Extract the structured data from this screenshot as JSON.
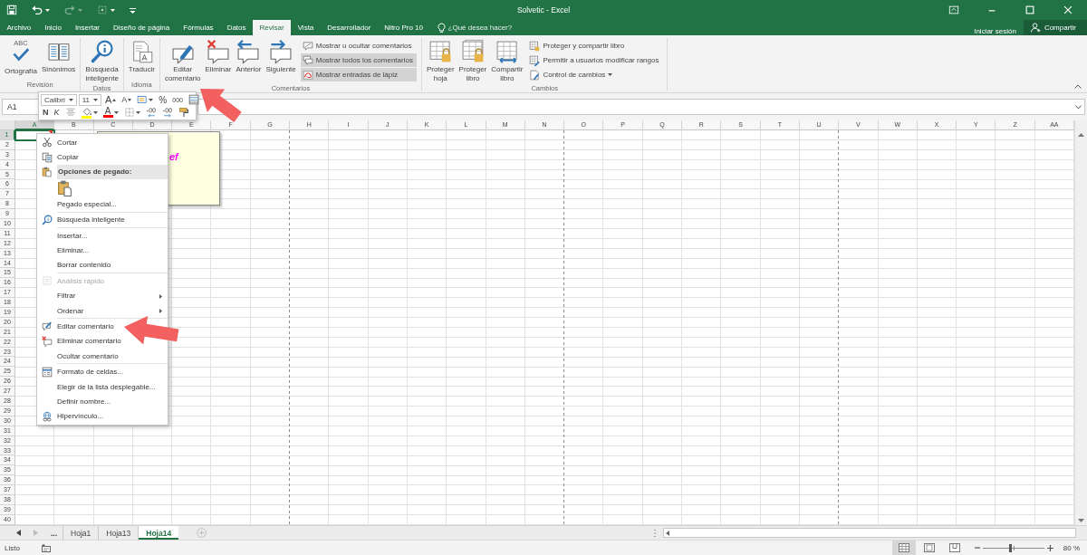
{
  "window": {
    "title": "Solvetic - Excel"
  },
  "tabs": [
    {
      "label": "Archivo",
      "selected": false
    },
    {
      "label": "Inicio",
      "selected": false
    },
    {
      "label": "Insertar",
      "selected": false
    },
    {
      "label": "Diseño de página",
      "selected": false
    },
    {
      "label": "Fórmulas",
      "selected": false
    },
    {
      "label": "Datos",
      "selected": false
    },
    {
      "label": "Revisar",
      "selected": true
    },
    {
      "label": "Vista",
      "selected": false
    },
    {
      "label": "Desarrollador",
      "selected": false
    },
    {
      "label": "Nitro Pro 10",
      "selected": false
    }
  ],
  "tell_me": {
    "placeholder": "¿Qué desea hacer?"
  },
  "sign_in": "Iniciar sesión",
  "share_button": "Compartir",
  "ribbon": {
    "groups": [
      {
        "label": "Revisión",
        "large": [
          {
            "label": "Ortografía",
            "kind": "spelling",
            "icon_text": "ABC"
          },
          {
            "label": "Sinónimos",
            "kind": "thesaurus"
          }
        ]
      },
      {
        "label": "Datos",
        "large": [
          {
            "label": "Búsqueda inteligente",
            "kind": "smart-lookup"
          }
        ]
      },
      {
        "label": "Idioma",
        "large": [
          {
            "label": "Traducir",
            "kind": "translate"
          }
        ]
      },
      {
        "label": "Comentarios",
        "large": [
          {
            "label": "Editar comentario",
            "kind": "edit-comment"
          },
          {
            "label": "Eliminar",
            "kind": "delete-comment"
          },
          {
            "label": "Anterior",
            "kind": "previous-comment"
          },
          {
            "label": "Siguiente",
            "kind": "next-comment"
          }
        ],
        "small": [
          {
            "label": "Mostrar u ocultar comentarios",
            "kind": "show-comment",
            "selected": false,
            "dropdown": false
          },
          {
            "label": "Mostrar todos los comentarios",
            "kind": "show-all",
            "selected": true,
            "dropdown": false
          },
          {
            "label": "Mostrar entradas de lápiz",
            "kind": "ink",
            "selected": true,
            "dropdown": false
          }
        ]
      },
      {
        "label": "Cambios",
        "large": [
          {
            "label": "Proteger hoja",
            "kind": "protect-sheet"
          },
          {
            "label": "Proteger libro",
            "kind": "protect-book"
          },
          {
            "label": "Compartir libro",
            "kind": "share-book"
          }
        ],
        "small": [
          {
            "label": "Proteger y compartir libro",
            "kind": "protect-share",
            "selected": false,
            "dropdown": false
          },
          {
            "label": "Permitir a usuarios modificar rangos",
            "kind": "allow-ranges",
            "selected": false,
            "dropdown": false
          },
          {
            "label": "Control de cambios",
            "kind": "track-changes",
            "selected": false,
            "dropdown": true
          }
        ]
      }
    ]
  },
  "formula_bar": {
    "name_box": "A1"
  },
  "mini_toolbar": {
    "top_row": [
      {
        "kind": "font-box",
        "value": "Calibri"
      },
      {
        "kind": "size-box",
        "value": "11"
      },
      {
        "kind": "grow",
        "label": "A"
      },
      {
        "kind": "shrink",
        "label": "A"
      },
      {
        "kind": "cell-styles"
      },
      {
        "kind": "percent",
        "label": "%"
      },
      {
        "kind": "thousands",
        "label": "000"
      },
      {
        "kind": "format-table"
      }
    ],
    "bottom_row": [
      {
        "kind": "bold",
        "label": "N"
      },
      {
        "kind": "italic",
        "label": "K"
      },
      {
        "kind": "align"
      },
      {
        "kind": "fill",
        "color": "#ffff00"
      },
      {
        "kind": "font-color",
        "label": "A",
        "color": "#ff0000"
      },
      {
        "kind": "borders"
      },
      {
        "kind": "increase-decimals"
      },
      {
        "kind": "decrease-decimals"
      },
      {
        "kind": "painter"
      }
    ]
  },
  "sheet": {
    "columns": [
      {
        "label": "A",
        "selected": true,
        "page_break": false
      },
      {
        "label": "B",
        "selected": false,
        "page_break": false
      },
      {
        "label": "C",
        "selected": false,
        "page_break": false
      },
      {
        "label": "D",
        "selected": false,
        "page_break": false
      },
      {
        "label": "E",
        "selected": false,
        "page_break": false
      },
      {
        "label": "F",
        "selected": false,
        "page_break": false
      },
      {
        "label": "G",
        "selected": false,
        "page_break": true
      },
      {
        "label": "H",
        "selected": false,
        "page_break": false
      },
      {
        "label": "I",
        "selected": false,
        "page_break": false
      },
      {
        "label": "J",
        "selected": false,
        "page_break": false
      },
      {
        "label": "K",
        "selected": false,
        "page_break": false
      },
      {
        "label": "L",
        "selected": false,
        "page_break": false
      },
      {
        "label": "M",
        "selected": false,
        "page_break": false
      },
      {
        "label": "N",
        "selected": false,
        "page_break": true
      },
      {
        "label": "O",
        "selected": false,
        "page_break": false
      },
      {
        "label": "P",
        "selected": false,
        "page_break": false
      },
      {
        "label": "Q",
        "selected": false,
        "page_break": false
      },
      {
        "label": "R",
        "selected": false,
        "page_break": false
      },
      {
        "label": "S",
        "selected": false,
        "page_break": false
      },
      {
        "label": "T",
        "selected": false,
        "page_break": false
      },
      {
        "label": "U",
        "selected": false,
        "page_break": true
      },
      {
        "label": "V",
        "selected": false,
        "page_break": false
      },
      {
        "label": "W",
        "selected": false,
        "page_break": false
      },
      {
        "label": "X",
        "selected": false,
        "page_break": false
      },
      {
        "label": "Y",
        "selected": false,
        "page_break": false
      },
      {
        "label": "Z",
        "selected": false,
        "page_break": false
      },
      {
        "label": "AA",
        "selected": false,
        "page_break": false
      }
    ],
    "rows": [
      {
        "label": "1",
        "selected": true
      },
      {
        "label": "2",
        "selected": false
      },
      {
        "label": "3",
        "selected": false
      },
      {
        "label": "4",
        "selected": false
      },
      {
        "label": "5",
        "selected": false
      },
      {
        "label": "6",
        "selected": false
      },
      {
        "label": "7",
        "selected": false
      },
      {
        "label": "8",
        "selected": false
      },
      {
        "label": "9",
        "selected": false
      },
      {
        "label": "10",
        "selected": false
      },
      {
        "label": "11",
        "selected": false
      },
      {
        "label": "12",
        "selected": false
      },
      {
        "label": "13",
        "selected": false
      },
      {
        "label": "14",
        "selected": false
      },
      {
        "label": "15",
        "selected": false
      },
      {
        "label": "16",
        "selected": false
      },
      {
        "label": "17",
        "selected": false
      },
      {
        "label": "18",
        "selected": false
      },
      {
        "label": "19",
        "selected": false
      },
      {
        "label": "20",
        "selected": false
      },
      {
        "label": "21",
        "selected": false
      },
      {
        "label": "22",
        "selected": false
      },
      {
        "label": "23",
        "selected": false
      },
      {
        "label": "24",
        "selected": false
      },
      {
        "label": "25",
        "selected": false
      },
      {
        "label": "26",
        "selected": false
      },
      {
        "label": "27",
        "selected": false
      },
      {
        "label": "28",
        "selected": false
      },
      {
        "label": "29",
        "selected": false
      },
      {
        "label": "30",
        "selected": false
      },
      {
        "label": "31",
        "selected": false
      },
      {
        "label": "32",
        "selected": false
      },
      {
        "label": "33",
        "selected": false
      },
      {
        "label": "34",
        "selected": false
      },
      {
        "label": "35",
        "selected": false
      },
      {
        "label": "36",
        "selected": false
      },
      {
        "label": "37",
        "selected": false
      },
      {
        "label": "38",
        "selected": false
      },
      {
        "label": "39",
        "selected": false
      },
      {
        "label": "40",
        "selected": false
      }
    ],
    "comment": {
      "text": "ef"
    }
  },
  "context_menu": [
    {
      "kind": "cut",
      "label": "Cortar",
      "disabled": false,
      "submenu": false
    },
    {
      "kind": "copy",
      "label": "Copiar",
      "disabled": false,
      "submenu": false
    },
    {
      "kind": "header",
      "label": "Opciones de pegado:"
    },
    {
      "kind": "paste-options"
    },
    {
      "kind": "plain",
      "label": "Pegado especial...",
      "disabled": false,
      "submenu": false
    },
    {
      "kind": "separator"
    },
    {
      "kind": "smart-lookup",
      "label": "Búsqueda inteligente",
      "disabled": false,
      "submenu": false
    },
    {
      "kind": "separator"
    },
    {
      "kind": "plain",
      "label": "Insertar...",
      "disabled": false,
      "submenu": false
    },
    {
      "kind": "plain",
      "label": "Eliminar...",
      "disabled": false,
      "submenu": false
    },
    {
      "kind": "plain",
      "label": "Borrar contenido",
      "disabled": false,
      "submenu": false
    },
    {
      "kind": "separator"
    },
    {
      "kind": "quick-analysis",
      "label": "Análisis rápido",
      "disabled": true,
      "submenu": false
    },
    {
      "kind": "plain",
      "label": "Filtrar",
      "disabled": false,
      "submenu": true
    },
    {
      "kind": "plain",
      "label": "Ordenar",
      "disabled": false,
      "submenu": true
    },
    {
      "kind": "separator"
    },
    {
      "kind": "edit-comment",
      "label": "Editar comentario",
      "disabled": false,
      "submenu": false
    },
    {
      "kind": "delete-comment",
      "label": "Eliminar comentario",
      "disabled": false,
      "submenu": false
    },
    {
      "kind": "plain",
      "label": "Ocultar comentario",
      "disabled": false,
      "submenu": false
    },
    {
      "kind": "separator"
    },
    {
      "kind": "format-cells",
      "label": "Formato de celdas...",
      "disabled": false,
      "submenu": false
    },
    {
      "kind": "plain",
      "label": "Elegir de la lista desplegable...",
      "disabled": false,
      "submenu": false
    },
    {
      "kind": "plain",
      "label": "Definir nombre...",
      "disabled": false,
      "submenu": false
    },
    {
      "kind": "hyperlink",
      "label": "Hipervínculo...",
      "disabled": false,
      "submenu": false
    }
  ],
  "sheet_tabs": {
    "more": "...",
    "sheets": [
      {
        "label": "Hoja1",
        "selected": false
      },
      {
        "label": "Hoja13",
        "selected": false
      },
      {
        "label": "Hoja14",
        "selected": true
      }
    ]
  },
  "status_bar": {
    "status": "Listo",
    "views": [
      {
        "kind": "normal",
        "selected": true
      },
      {
        "kind": "page-layout",
        "selected": false
      },
      {
        "kind": "page-break-preview",
        "selected": false
      }
    ],
    "zoom": {
      "level": 0.45,
      "reading": "80 %"
    }
  }
}
